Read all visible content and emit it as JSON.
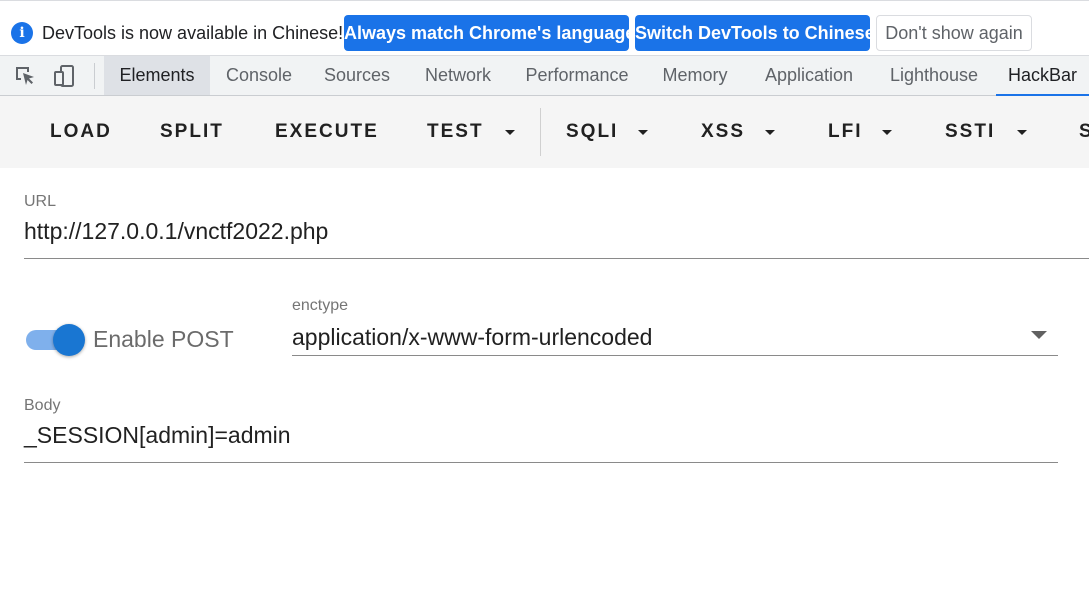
{
  "infobar": {
    "message": "DevTools is now available in Chinese!",
    "buttons": {
      "match": "Always match Chrome's language",
      "switch": "Switch DevTools to Chinese",
      "dismiss": "Don't show again"
    }
  },
  "tabs": [
    "Elements",
    "Console",
    "Sources",
    "Network",
    "Performance",
    "Memory",
    "Application",
    "Lighthouse",
    "HackBar"
  ],
  "toolbar": {
    "load": "LOAD",
    "split": "SPLIT",
    "execute": "EXECUTE",
    "test": "TEST",
    "sqli": "SQLI",
    "xss": "XSS",
    "lfi": "LFI",
    "ssti": "SSTI",
    "overflow": "S"
  },
  "form": {
    "url_label": "URL",
    "url_value": "http://127.0.0.1/vnctf2022.php",
    "enable_post_label": "Enable POST",
    "enable_post": true,
    "enctype_label": "enctype",
    "enctype_value": "application/x-www-form-urlencoded",
    "body_label": "Body",
    "body_value": "_SESSION[admin]=admin"
  },
  "colors": {
    "accent": "#1a73e8",
    "switch_thumb": "#1976d2",
    "switch_track": "#7fb0ec"
  }
}
